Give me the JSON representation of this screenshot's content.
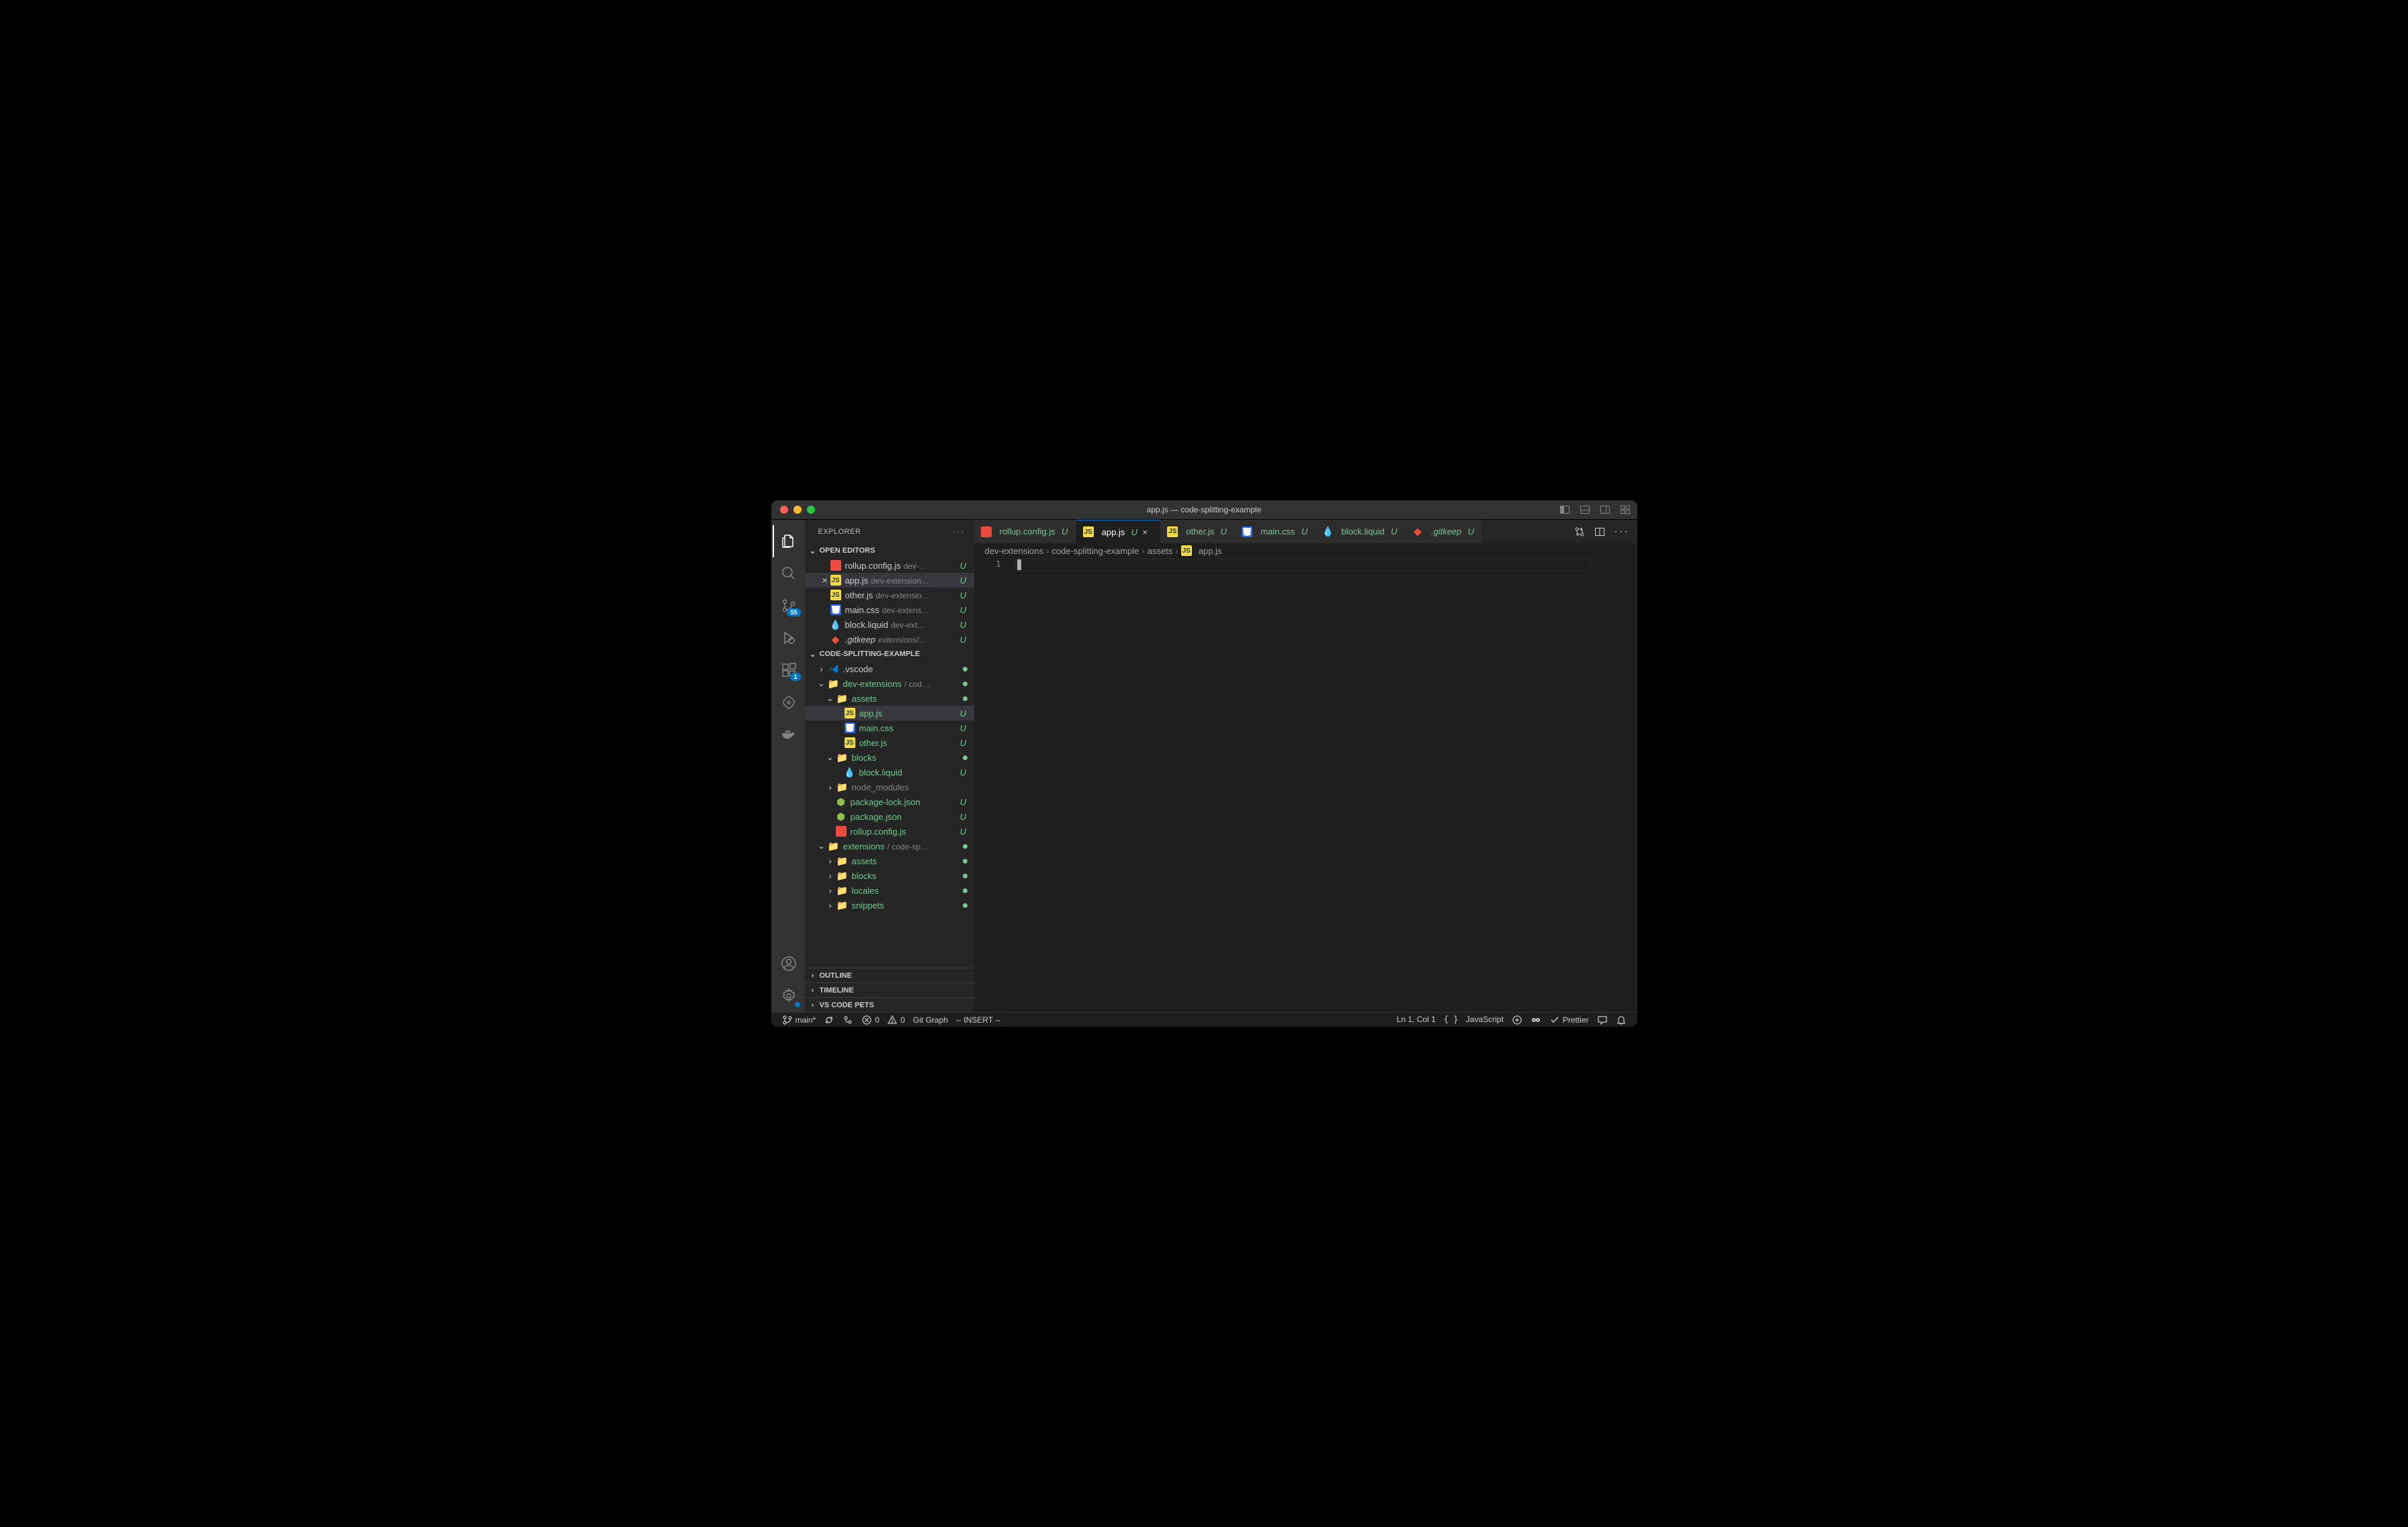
{
  "title": "app.js — code-splitting-example",
  "activitybar": {
    "scm_badge": "55",
    "ext_badge": "1"
  },
  "sidebar": {
    "title": "EXPLORER",
    "open_editors_label": "OPEN EDITORS",
    "open_editors": [
      {
        "icon": "roll",
        "name": "rollup.config.js",
        "path": "dev-…",
        "stat": "U"
      },
      {
        "icon": "js",
        "name": "app.js",
        "path": "dev-extension…",
        "stat": "U",
        "active": true
      },
      {
        "icon": "js",
        "name": "other.js",
        "path": "dev-extensio…",
        "stat": "U"
      },
      {
        "icon": "css",
        "name": "main.css",
        "path": "dev-extens…",
        "stat": "U"
      },
      {
        "icon": "liq",
        "name": "block.liquid",
        "path": "dev-ext…",
        "stat": "U"
      },
      {
        "icon": "git",
        "name": ".gitkeep",
        "path": "extensions/…",
        "stat": "U",
        "italic": true
      }
    ],
    "workspace_label": "CODE-SPLITTING-EXAMPLE",
    "tree": [
      {
        "d": 1,
        "chev": "r",
        "icon": "vsc",
        "name": ".vscode",
        "dot": true
      },
      {
        "d": 1,
        "chev": "d",
        "icon": "fold-y",
        "name": "dev-extensions",
        "path": "/ cod…",
        "dot": true,
        "green": true
      },
      {
        "d": 2,
        "chev": "d",
        "icon": "fold-y",
        "name": "assets",
        "dot": true,
        "green": true
      },
      {
        "d": 3,
        "icon": "js",
        "name": "app.js",
        "stat": "U",
        "active": true,
        "green": true
      },
      {
        "d": 3,
        "icon": "css",
        "name": "main.css",
        "stat": "U",
        "green": true
      },
      {
        "d": 3,
        "icon": "js",
        "name": "other.js",
        "stat": "U",
        "green": true
      },
      {
        "d": 2,
        "chev": "d",
        "icon": "fold-y",
        "name": "blocks",
        "dot": true,
        "green": true
      },
      {
        "d": 3,
        "icon": "liq",
        "name": "block.liquid",
        "stat": "U",
        "green": true
      },
      {
        "d": 2,
        "chev": "r",
        "icon": "fold-g",
        "name": "node_modules",
        "gray": true
      },
      {
        "d": 2,
        "icon": "json",
        "name": "package-lock.json",
        "stat": "U",
        "green": true
      },
      {
        "d": 2,
        "icon": "json",
        "name": "package.json",
        "stat": "U",
        "green": true
      },
      {
        "d": 2,
        "icon": "roll",
        "name": "rollup.config.js",
        "stat": "U",
        "green": true
      },
      {
        "d": 1,
        "chev": "d",
        "icon": "fold-y",
        "name": "extensions",
        "path": "/ code-sp…",
        "dot": true,
        "green": true
      },
      {
        "d": 2,
        "chev": "r",
        "icon": "fold-y",
        "name": "assets",
        "dot": true,
        "green": true
      },
      {
        "d": 2,
        "chev": "r",
        "icon": "fold-b",
        "name": "blocks",
        "dot": true,
        "green": true
      },
      {
        "d": 2,
        "chev": "r",
        "icon": "fold-p",
        "name": "locales",
        "dot": true,
        "green": true
      },
      {
        "d": 2,
        "chev": "r",
        "icon": "fold-y",
        "name": "snippets",
        "dot": true,
        "green": true
      }
    ],
    "outline_label": "OUTLINE",
    "timeline_label": "TIMELINE",
    "pets_label": "VS CODE PETS"
  },
  "tabs": [
    {
      "icon": "roll",
      "name": "rollup.config.js",
      "stat": "U"
    },
    {
      "icon": "js",
      "name": "app.js",
      "stat": "U",
      "active": true
    },
    {
      "icon": "js",
      "name": "other.js",
      "stat": "U"
    },
    {
      "icon": "css",
      "name": "main.css",
      "stat": "U"
    },
    {
      "icon": "liq",
      "name": "block.liquid",
      "stat": "U"
    },
    {
      "icon": "git",
      "name": ".gitkeep",
      "stat": "U",
      "italic": true
    }
  ],
  "breadcrumb": [
    "dev-extensions",
    "code-splitting-example",
    "assets",
    "app.js"
  ],
  "editor": {
    "line": "1"
  },
  "status": {
    "branch": "main*",
    "errors": "0",
    "warnings": "0",
    "gitgraph": "Git Graph",
    "mode": "-- INSERT --",
    "cursor": "Ln 1, Col 1",
    "lang": "JavaScript",
    "prettier": "Prettier"
  }
}
